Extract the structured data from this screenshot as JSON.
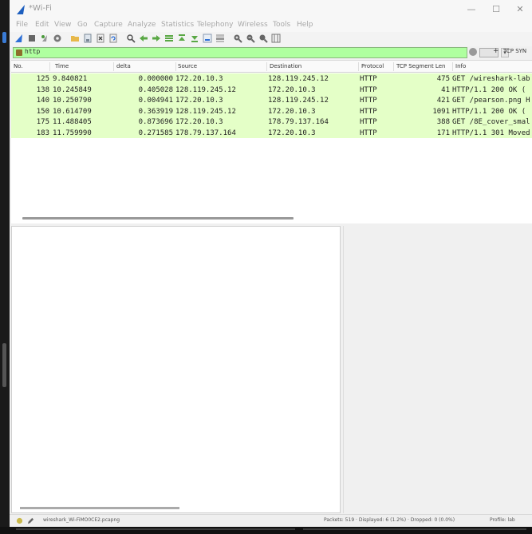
{
  "window": {
    "title": "*Wi-Fi"
  },
  "titlebar": {
    "minimize": "—",
    "maximize": "☐",
    "close": "✕"
  },
  "menu": [
    "File",
    "Edit",
    "View",
    "Go",
    "Capture",
    "Analyze",
    "Statistics",
    "Telephony",
    "Wireless",
    "Tools",
    "Help"
  ],
  "toolbar": {
    "icons": [
      "shark-fin-start-icon",
      "stop-icon",
      "restart-icon",
      "options-gear-icon",
      "open-folder-icon",
      "save-file-icon",
      "close-file-icon",
      "reload-icon",
      "find-packet-icon",
      "go-back-icon",
      "go-forward-icon",
      "go-to-packet-icon",
      "go-first-icon",
      "go-last-icon",
      "autoscroll-icon",
      "colorize-icon",
      "zoom-in-icon",
      "zoom-out-icon",
      "zoom-normal-icon",
      "resize-columns-icon"
    ]
  },
  "filter": {
    "value": "http",
    "plus": "+",
    "button_label": "TCP SYN"
  },
  "packet_list": {
    "columns": [
      "No.",
      "Time",
      "delta",
      "Source",
      "Destination",
      "Protocol",
      "TCP Segment Len",
      "Info"
    ],
    "rows": [
      {
        "no": "125",
        "time": "9.840821",
        "delta": "0.000000",
        "source": "172.20.10.3",
        "destination": "128.119.245.12",
        "protocol": "HTTP",
        "seglen": "475",
        "info": "GET /wireshark-lab"
      },
      {
        "no": "138",
        "time": "10.245849",
        "delta": "0.405028",
        "source": "128.119.245.12",
        "destination": "172.20.10.3",
        "protocol": "HTTP",
        "seglen": "41",
        "info": "HTTP/1.1 200 OK  ("
      },
      {
        "no": "140",
        "time": "10.250790",
        "delta": "0.004941",
        "source": "172.20.10.3",
        "destination": "128.119.245.12",
        "protocol": "HTTP",
        "seglen": "421",
        "info": "GET /pearson.png H"
      },
      {
        "no": "150",
        "time": "10.614709",
        "delta": "0.363919",
        "source": "128.119.245.12",
        "destination": "172.20.10.3",
        "protocol": "HTTP",
        "seglen": "1091",
        "info": "HTTP/1.1 200 OK  ("
      },
      {
        "no": "175",
        "time": "11.488405",
        "delta": "0.873696",
        "source": "172.20.10.3",
        "destination": "178.79.137.164",
        "protocol": "HTTP",
        "seglen": "388",
        "info": "GET /8E_cover_smal"
      },
      {
        "no": "183",
        "time": "11.759990",
        "delta": "0.271585",
        "source": "178.79.137.164",
        "destination": "172.20.10.3",
        "protocol": "HTTP",
        "seglen": "171",
        "info": "HTTP/1.1 301 Moved"
      }
    ]
  },
  "status": {
    "file": "wireshark_Wi-FiMO0CE2.pcapng",
    "packets": "Packets: 519 · Displayed: 6 (1.2%) · Dropped: 0 (0.0%)",
    "profile": "Profile: lab"
  },
  "colors": {
    "http_row": "#e4ffc7",
    "filter_ok": "#afff9f"
  }
}
